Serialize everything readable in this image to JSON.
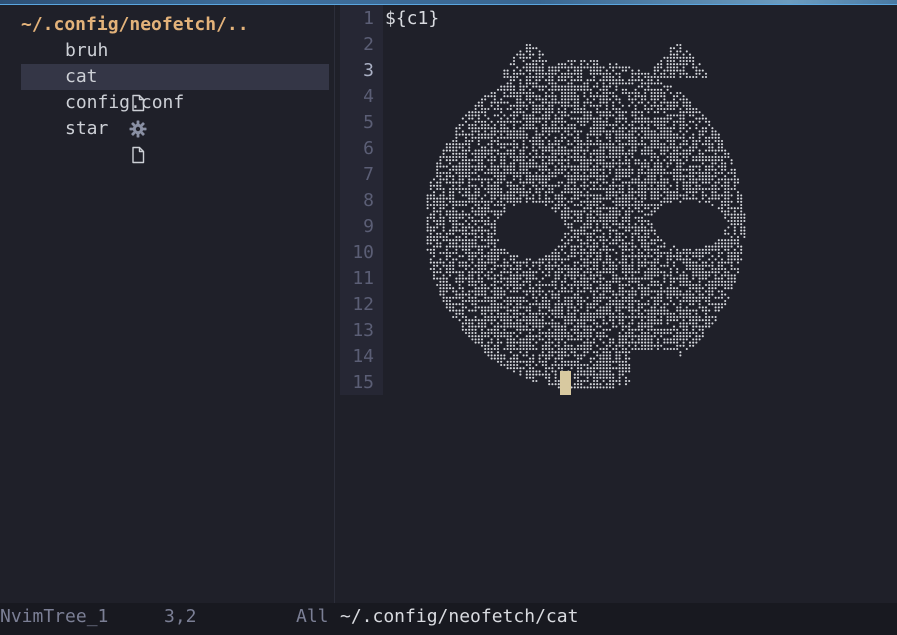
{
  "tree": {
    "root_label": "~/.config/neofetch/..",
    "items": [
      {
        "label": "bruh",
        "icon": "file-icon",
        "selected": false
      },
      {
        "label": "cat",
        "icon": "file-icon",
        "selected": true
      },
      {
        "label": "config.conf",
        "icon": "gear-icon",
        "selected": false
      },
      {
        "label": "star",
        "icon": "file-icon",
        "selected": false
      }
    ]
  },
  "editor": {
    "line_numbers": [
      "1",
      "2",
      "3",
      "4",
      "5",
      "6",
      "7",
      "8",
      "9",
      "10",
      "11",
      "12",
      "13",
      "14",
      "15"
    ],
    "current_line": "3",
    "first_line_text": "${c1}",
    "ascii_art": "cat (braille dot drawing)"
  },
  "statusline": {
    "buffer_name": "NvimTree_1",
    "position": "3,2",
    "scroll": "All",
    "file_path": "~/.config/neofetch/cat"
  },
  "colors": {
    "background": "#1f2029",
    "gutter": "#262734",
    "selection": "#343646",
    "root_label": "#e3b27a",
    "text": "#d9dbe0",
    "line_number": "#5b5e75",
    "cursor": "#d8c9a0"
  }
}
